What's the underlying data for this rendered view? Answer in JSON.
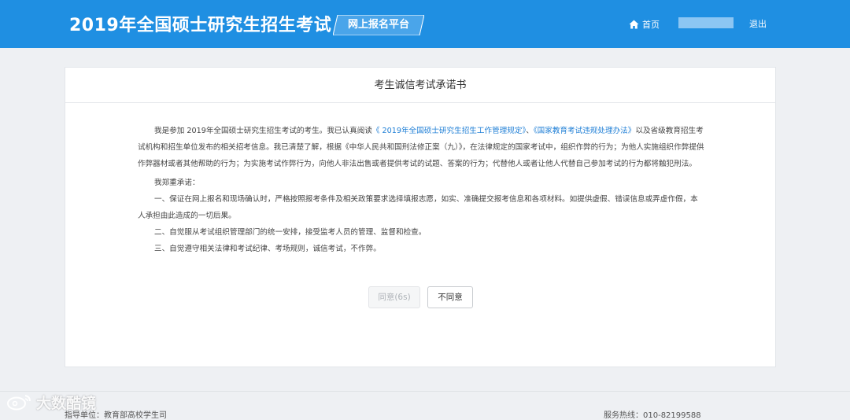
{
  "header": {
    "title": "2019年全国硕士研究生招生考试",
    "platform": "网上报名平台",
    "home": "首页",
    "logout": "退出"
  },
  "pledge": {
    "title": "考生诚信考试承诺书",
    "para1_a": "我是参加 2019年全国硕士研究生招生考试的考生。我已认真阅读",
    "link1": "《 2019年全国硕士研究生招生工作管理规定》",
    "para1_sep": "、",
    "link2": "《国家教育考试违规处理办法》",
    "para1_b": "以及省级教育招生考试机构和招生单位发布的相关招考信息。我已清楚了解，根据《中华人民共和国刑法修正案（九）》，在法律规定的国家考试中，组织作弊的行为；为他人实施组织作弊提供作弊器材或者其他帮助的行为；为实施考试作弊行为，向他人非法出售或者提供考试的试题、答案的行为；代替他人或者让他人代替自己参加考试的行为都将触犯刑法。",
    "promise_intro": "我郑重承诺：",
    "item1": "一、保证在网上报名和现场确认时，严格按照报考条件及相关政策要求选择填报志愿，如实、准确提交报考信息和各项材料。如提供虚假、错误信息或弄虚作假，本人承担由此造成的一切后果。",
    "item2": "二、自觉服从考试组织管理部门的统一安排，接受监考人员的管理、监督和检查。",
    "item3": "三、自觉遵守相关法律和考试纪律、考场规则，诚信考试，不作弊。"
  },
  "buttons": {
    "agree": "同意(6s)",
    "disagree": "不同意"
  },
  "footer": {
    "left": "指导单位：教育部高校学生司",
    "right": "服务热线：010-82199588"
  },
  "watermark": {
    "text": "大数酷镜"
  },
  "colors": {
    "header_bg": "#1f8fe2",
    "link": "#1f7fd6"
  },
  "icons": {
    "home": "home-icon",
    "watermark": "weibo-logo-icon"
  }
}
